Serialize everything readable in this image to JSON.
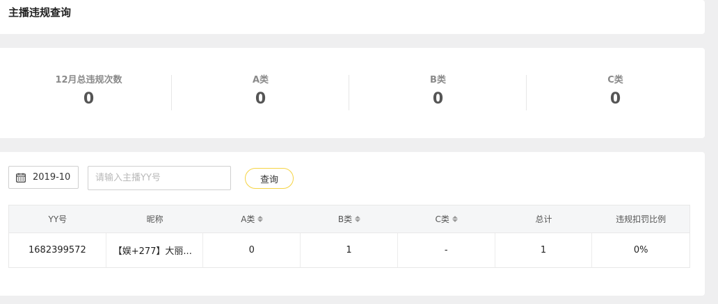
{
  "header": {
    "title": "主播违规查询"
  },
  "stats": [
    {
      "label": "12月总违规次数",
      "value": "0"
    },
    {
      "label": "A类",
      "value": "0"
    },
    {
      "label": "B类",
      "value": "0"
    },
    {
      "label": "C类",
      "value": "0"
    }
  ],
  "filters": {
    "date_value": "2019-10",
    "search_placeholder": "请输入主播YY号",
    "query_label": "查询"
  },
  "table": {
    "columns": [
      "YY号",
      "昵称",
      "A类",
      "B类",
      "C类",
      "总计",
      "违规扣罚比例"
    ],
    "sortable_columns": [
      "A类",
      "B类",
      "C类"
    ],
    "rows": [
      {
        "yy": "1682399572",
        "nickname": "【娱+277】大丽...",
        "a": "0",
        "b": "1",
        "c": "-",
        "total": "1",
        "ratio": "0%"
      }
    ]
  },
  "colors": {
    "page_background": "#efeff0",
    "panel_background": "#ffffff",
    "accent_button_border": "#f5d342",
    "table_header_background": "#f5f6f7"
  }
}
